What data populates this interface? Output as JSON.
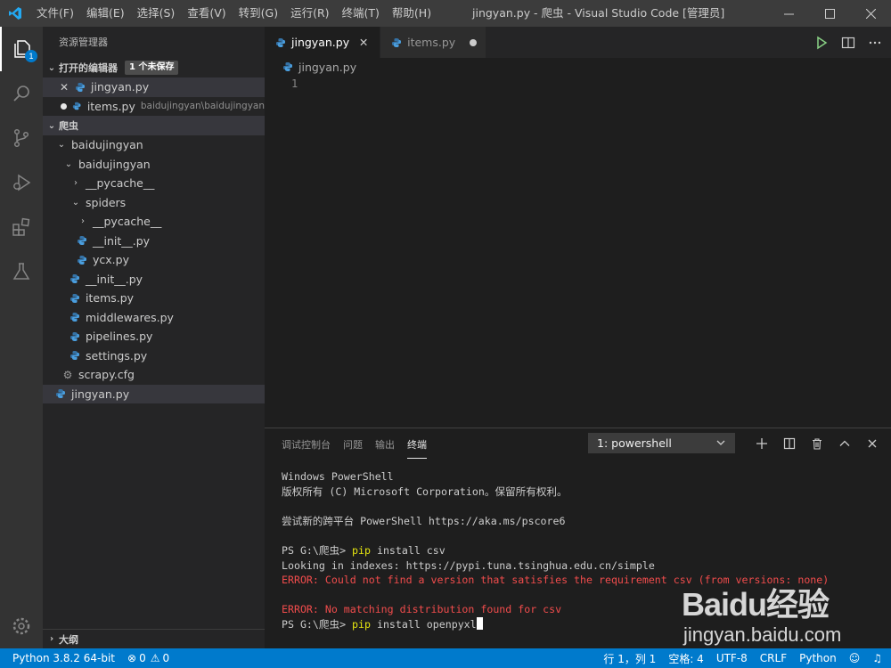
{
  "window": {
    "title": "jingyan.py - 爬虫 - Visual Studio Code [管理员]",
    "menu": [
      "文件(F)",
      "编辑(E)",
      "选择(S)",
      "查看(V)",
      "转到(G)",
      "运行(R)",
      "终端(T)",
      "帮助(H)"
    ]
  },
  "activity": {
    "explorer_badge": "1"
  },
  "sidebar": {
    "title": "资源管理器",
    "open_editors": {
      "header": "打开的编辑器",
      "badge": "1 个未保存",
      "items": [
        {
          "name": "jingyan.py",
          "path": ""
        },
        {
          "name": "items.py",
          "path": "baidujingyan\\baidujingyan"
        }
      ]
    },
    "workspace": {
      "header": "爬虫",
      "tree": [
        "baidujingyan",
        "baidujingyan",
        "__pycache__",
        "spiders",
        "__pycache__",
        "__init__.py",
        "ycx.py",
        "__init__.py",
        "items.py",
        "middlewares.py",
        "pipelines.py",
        "settings.py",
        "scrapy.cfg",
        "jingyan.py"
      ]
    },
    "outline_header": "大纲"
  },
  "editor": {
    "tabs": [
      {
        "label": "jingyan.py"
      },
      {
        "label": "items.py"
      }
    ],
    "breadcrumb": "jingyan.py",
    "line_number": "1"
  },
  "panel": {
    "tabs": [
      "调试控制台",
      "问题",
      "输出",
      "终端"
    ],
    "terminal_select": "1: powershell",
    "lines": {
      "l1": "Windows PowerShell",
      "l2": "版权所有 (C) Microsoft Corporation。保留所有权利。",
      "l3": "尝试新的跨平台 PowerShell https://aka.ms/pscore6",
      "prompt": "PS G:\\爬虫> ",
      "cmd1": "pip",
      "args1": " install csv",
      "l5": "Looking in indexes: https://pypi.tuna.tsinghua.edu.cn/simple",
      "err1": "ERROR: Could not find a version that satisfies the requirement csv (from versions: none)",
      "err2": "ERROR: No matching distribution found for csv",
      "cmd2": "pip",
      "args2": " install openpyxl"
    }
  },
  "statusbar": {
    "python": "Python 3.8.2 64-bit",
    "errors": "0",
    "warnings": "0",
    "position": "行 1，列 1",
    "spaces": "空格: 4",
    "encoding": "UTF-8",
    "eol": "CRLF",
    "language": "Python"
  },
  "watermark": {
    "logo": "Baidu经验",
    "url": "jingyan.baidu.com"
  },
  "colors": {
    "accent": "#007acc",
    "error": "#f14c4c",
    "command": "#e5e510"
  }
}
